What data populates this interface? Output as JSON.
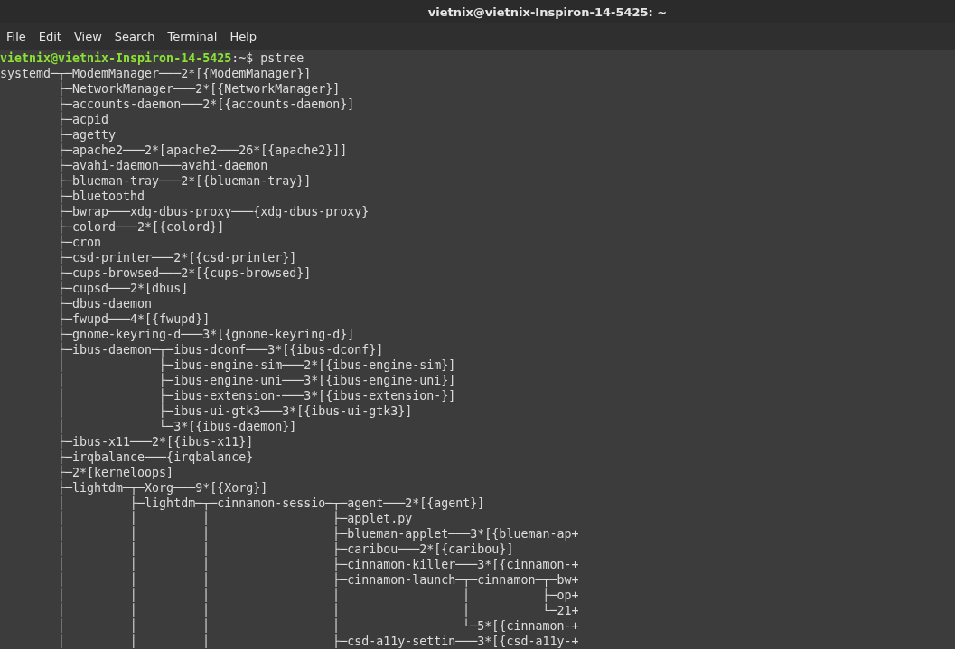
{
  "window": {
    "title": "vietnix@vietnix-Inspiron-14-5425: ~"
  },
  "menu": [
    "File",
    "Edit",
    "View",
    "Search",
    "Terminal",
    "Help"
  ],
  "terminal": {
    "prompt": {
      "user_host": "vietnix@vietnix-Inspiron-14-5425",
      "rest": ":~$ pstree"
    },
    "lines": [
      "systemd─┬─ModemManager───2*[{ModemManager}]",
      "        ├─NetworkManager───2*[{NetworkManager}]",
      "        ├─accounts-daemon───2*[{accounts-daemon}]",
      "        ├─acpid",
      "        ├─agetty",
      "        ├─apache2───2*[apache2───26*[{apache2}]]",
      "        ├─avahi-daemon───avahi-daemon",
      "        ├─blueman-tray───2*[{blueman-tray}]",
      "        ├─bluetoothd",
      "        ├─bwrap───xdg-dbus-proxy───{xdg-dbus-proxy}",
      "        ├─colord───2*[{colord}]",
      "        ├─cron",
      "        ├─csd-printer───2*[{csd-printer}]",
      "        ├─cups-browsed───2*[{cups-browsed}]",
      "        ├─cupsd───2*[dbus]",
      "        ├─dbus-daemon",
      "        ├─fwupd───4*[{fwupd}]",
      "        ├─gnome-keyring-d───3*[{gnome-keyring-d}]",
      "        ├─ibus-daemon─┬─ibus-dconf───3*[{ibus-dconf}]",
      "        │             ├─ibus-engine-sim───2*[{ibus-engine-sim}]",
      "        │             ├─ibus-engine-uni───3*[{ibus-engine-uni}]",
      "        │             ├─ibus-extension-───3*[{ibus-extension-}]",
      "        │             ├─ibus-ui-gtk3───3*[{ibus-ui-gtk3}]",
      "        │             └─3*[{ibus-daemon}]",
      "        ├─ibus-x11───2*[{ibus-x11}]",
      "        ├─irqbalance───{irqbalance}",
      "        ├─2*[kerneloops]",
      "        ├─lightdm─┬─Xorg───9*[{Xorg}]",
      "        │         ├─lightdm─┬─cinnamon-sessio─┬─agent───2*[{agent}]",
      "        │         │         │                 ├─applet.py",
      "        │         │         │                 ├─blueman-applet───3*[{blueman-ap+",
      "        │         │         │                 ├─caribou───2*[{caribou}]",
      "        │         │         │                 ├─cinnamon-killer───3*[{cinnamon-+",
      "        │         │         │                 ├─cinnamon-launch─┬─cinnamon─┬─bw+",
      "        │         │         │                 │                 │          ├─op+",
      "        │         │         │                 │                 │          └─21+",
      "        │         │         │                 │                 └─5*[{cinnamon-+",
      "        │         │         │                 ├─csd-a11y-settin───3*[{csd-a11y-+"
    ]
  }
}
